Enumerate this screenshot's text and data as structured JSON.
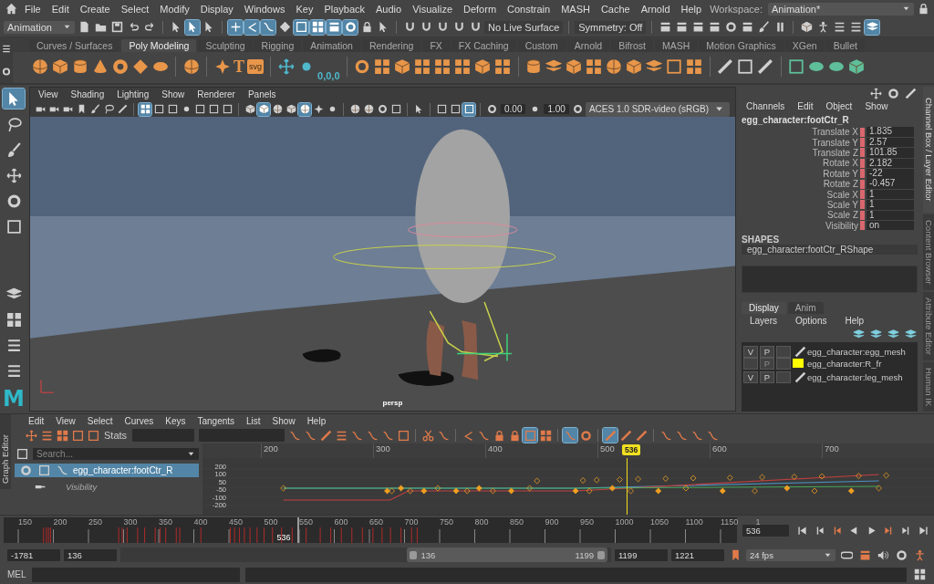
{
  "menu_bar": {
    "items": [
      "File",
      "Edit",
      "Create",
      "Select",
      "Modify",
      "Display",
      "Windows",
      "Key",
      "Playback",
      "Audio",
      "Visualize",
      "Deform",
      "Constrain",
      "MASH",
      "Cache",
      "Arnold",
      "Help"
    ],
    "workspace_label": "Workspace:",
    "workspace": "Animation*"
  },
  "status_line": {
    "mode": "Animation",
    "live_surface": "No Live Surface",
    "symmetry": "Symmetry: Off",
    "tools": [
      {
        "kind": "file",
        "selected": false
      },
      {
        "kind": "folder",
        "selected": false
      },
      {
        "kind": "floppy-disk",
        "selected": false
      },
      {
        "kind": "undo",
        "selected": false
      },
      {
        "kind": "redo",
        "selected": false
      },
      {
        "kind": "sep"
      },
      {
        "kind": "arrow-cursor",
        "selected": false
      },
      {
        "kind": "arrow-cursor",
        "selected": true
      },
      {
        "kind": "arrow-cursor",
        "selected": false
      },
      {
        "kind": "sep"
      },
      {
        "kind": "plus",
        "selected": true
      },
      {
        "kind": "angle",
        "selected": true
      },
      {
        "kind": "curve",
        "selected": true
      },
      {
        "kind": "diamond",
        "selected": false
      },
      {
        "kind": "square",
        "selected": true
      },
      {
        "kind": "grid",
        "selected": true
      },
      {
        "kind": "clapperboard",
        "selected": true
      },
      {
        "kind": "ring",
        "selected": true
      },
      {
        "kind": "lock",
        "selected": false
      },
      {
        "kind": "arrow-cursor",
        "selected": false
      },
      {
        "kind": "sep"
      },
      {
        "kind": "magnet",
        "selected": false
      },
      {
        "kind": "magnet",
        "selected": false
      },
      {
        "kind": "magnet",
        "selected": false
      },
      {
        "kind": "magnet",
        "selected": false
      },
      {
        "kind": "magnet",
        "selected": false
      }
    ],
    "render_tools": [
      {
        "kind": "clapperboard",
        "selected": false
      },
      {
        "kind": "clapperboard",
        "selected": false
      },
      {
        "kind": "clapperboard",
        "selected": false
      },
      {
        "kind": "clapperboard",
        "selected": false
      },
      {
        "kind": "ring",
        "selected": false
      },
      {
        "kind": "clapperboard",
        "selected": false
      },
      {
        "kind": "brush",
        "selected": false
      },
      {
        "kind": "pause",
        "selected": false
      },
      {
        "kind": "sep"
      },
      {
        "kind": "cube",
        "selected": false
      },
      {
        "kind": "figure",
        "selected": false
      },
      {
        "kind": "bars",
        "selected": false
      },
      {
        "kind": "bars",
        "selected": false
      },
      {
        "kind": "layers",
        "selected": true
      }
    ]
  },
  "shelf": {
    "tabs": [
      {
        "label": "Curves / Surfaces",
        "selected": false
      },
      {
        "label": "Poly Modeling",
        "selected": true
      },
      {
        "label": "Sculpting",
        "selected": false
      },
      {
        "label": "Rigging",
        "selected": false
      },
      {
        "label": "Animation",
        "selected": false
      },
      {
        "label": "Rendering",
        "selected": false
      },
      {
        "label": "FX",
        "selected": false
      },
      {
        "label": "FX Caching",
        "selected": false
      },
      {
        "label": "Custom",
        "selected": false
      },
      {
        "label": "Arnold",
        "selected": false
      },
      {
        "label": "Bifrost",
        "selected": false
      },
      {
        "label": "MASH",
        "selected": false
      },
      {
        "label": "Motion Graphics",
        "selected": false
      },
      {
        "label": "XGen",
        "selected": false
      },
      {
        "label": "Bullet",
        "selected": false
      }
    ],
    "items": [
      {
        "kind": "sphere",
        "color": "#e8964a"
      },
      {
        "kind": "cube",
        "color": "#e8964a"
      },
      {
        "kind": "cylinder",
        "color": "#e8964a"
      },
      {
        "kind": "cone",
        "color": "#e8964a"
      },
      {
        "kind": "torus",
        "color": "#e8964a"
      },
      {
        "kind": "diamond",
        "color": "#e8964a"
      },
      {
        "kind": "disc",
        "color": "#e8964a"
      },
      {
        "kind": "sep"
      },
      {
        "kind": "sphere",
        "color": "#e8964a"
      },
      {
        "kind": "sep"
      },
      {
        "kind": "star",
        "color": "#e8964a"
      },
      {
        "kind": "glyph",
        "label": "T",
        "color": "#e8964a"
      },
      {
        "kind": "tag",
        "label": "svg",
        "color": "#e8964a"
      },
      {
        "kind": "sep"
      },
      {
        "kind": "move-arrows",
        "color": "#4fb8cc"
      },
      {
        "kind": "dot",
        "color": "#4fb8cc"
      },
      {
        "kind": "glyph",
        "label": "0,0,0",
        "color": "#4fb8cc"
      },
      {
        "kind": "sep"
      },
      {
        "kind": "ring",
        "color": "#e8964a"
      },
      {
        "kind": "grid",
        "color": "#e8964a"
      },
      {
        "kind": "cube",
        "color": "#e8964a"
      },
      {
        "kind": "grid",
        "color": "#e8964a"
      },
      {
        "kind": "grid",
        "color": "#e8964a"
      },
      {
        "kind": "grid",
        "color": "#e8964a"
      },
      {
        "kind": "cube",
        "color": "#e8964a"
      },
      {
        "kind": "grid",
        "color": "#e8964a"
      },
      {
        "kind": "sep"
      },
      {
        "kind": "cylinder",
        "color": "#e8964a"
      },
      {
        "kind": "layers",
        "color": "#e8964a"
      },
      {
        "kind": "cube",
        "color": "#e8964a"
      },
      {
        "kind": "grid",
        "color": "#e8964a"
      },
      {
        "kind": "sphere",
        "color": "#e8964a"
      },
      {
        "kind": "cube",
        "color": "#e8964a"
      },
      {
        "kind": "layers",
        "color": "#e8964a"
      },
      {
        "kind": "square",
        "color": "#e8964a"
      },
      {
        "kind": "grid",
        "color": "#e8964a"
      },
      {
        "kind": "sep"
      },
      {
        "kind": "line",
        "color": "#cfcfcf"
      },
      {
        "kind": "square",
        "color": "#cfcfcf"
      },
      {
        "kind": "line",
        "color": "#cfcfcf"
      },
      {
        "kind": "sep"
      },
      {
        "kind": "square",
        "color": "#5fbf9a"
      },
      {
        "kind": "disc",
        "color": "#5fbf9a"
      },
      {
        "kind": "disc",
        "color": "#5fbf9a"
      },
      {
        "kind": "cube",
        "color": "#5fbf9a"
      }
    ]
  },
  "toolbox": {
    "tools": [
      {
        "kind": "arrow-cursor",
        "selected": true
      },
      {
        "kind": "lasso",
        "selected": false
      },
      {
        "kind": "brush",
        "selected": false
      },
      {
        "kind": "move-arrows",
        "selected": false
      },
      {
        "kind": "ring",
        "selected": false
      },
      {
        "kind": "square",
        "selected": false
      }
    ],
    "layouts": [
      {
        "kind": "layers"
      },
      {
        "kind": "grid"
      },
      {
        "kind": "bars"
      },
      {
        "kind": "bars"
      }
    ],
    "logo": "M"
  },
  "viewport": {
    "menu": [
      "View",
      "Shading",
      "Lighting",
      "Show",
      "Renderer",
      "Panels"
    ],
    "tools": [
      {
        "kind": "camera",
        "selected": false
      },
      {
        "kind": "camera",
        "selected": false
      },
      {
        "kind": "camera",
        "selected": false
      },
      {
        "kind": "bookmark",
        "selected": false
      },
      {
        "kind": "brush",
        "selected": false
      },
      {
        "kind": "lasso",
        "selected": false
      },
      {
        "kind": "line",
        "selected": false
      },
      {
        "kind": "sep"
      },
      {
        "kind": "grid",
        "selected": true
      },
      {
        "kind": "square",
        "selected": false
      },
      {
        "kind": "square",
        "selected": false
      },
      {
        "kind": "dot",
        "selected": false
      },
      {
        "kind": "square",
        "selected": false
      },
      {
        "kind": "square",
        "selected": false
      },
      {
        "kind": "square",
        "selected": false
      },
      {
        "kind": "sep"
      },
      {
        "kind": "cube",
        "selected": false
      },
      {
        "kind": "cube",
        "selected": true
      },
      {
        "kind": "sphere",
        "selected": false
      },
      {
        "kind": "cube",
        "selected": false
      },
      {
        "kind": "sphere",
        "selected": true
      },
      {
        "kind": "star",
        "selected": false
      },
      {
        "kind": "dot",
        "selected": false
      },
      {
        "kind": "sep"
      },
      {
        "kind": "sphere",
        "selected": false
      },
      {
        "kind": "sphere",
        "selected": false
      },
      {
        "kind": "ring",
        "selected": false
      },
      {
        "kind": "square",
        "selected": false
      },
      {
        "kind": "sep"
      },
      {
        "kind": "arrow-cursor",
        "selected": false
      },
      {
        "kind": "sep"
      },
      {
        "kind": "square",
        "selected": false
      },
      {
        "kind": "square",
        "selected": false
      },
      {
        "kind": "square",
        "selected": true
      },
      {
        "kind": "sep"
      },
      {
        "kind": "ring",
        "selected": false
      }
    ],
    "exposure": "0.00",
    "gamma": "1.00",
    "color_space": "ACES 1.0 SDR-video (sRGB)",
    "camera": "persp"
  },
  "channel_box": {
    "menu": [
      "Channels",
      "Edit",
      "Object",
      "Show"
    ],
    "node": "egg_character:footCtr_R",
    "channels": [
      {
        "name": "Translate X",
        "value": "1.835"
      },
      {
        "name": "Translate Y",
        "value": "2.57"
      },
      {
        "name": "Translate Z",
        "value": "101.85"
      },
      {
        "name": "Rotate X",
        "value": "2.182"
      },
      {
        "name": "Rotate Y",
        "value": "-22"
      },
      {
        "name": "Rotate Z",
        "value": "-0.457"
      },
      {
        "name": "Scale X",
        "value": "1"
      },
      {
        "name": "Scale Y",
        "value": "1"
      },
      {
        "name": "Scale Z",
        "value": "1"
      },
      {
        "name": "Visibility",
        "value": "on"
      }
    ],
    "shapes_title": "SHAPES",
    "shape": "egg_character:footCtr_RShape"
  },
  "layer_editor": {
    "tabs": [
      {
        "label": "Display",
        "selected": true
      },
      {
        "label": "Anim",
        "selected": false
      }
    ],
    "menu": [
      "Layers",
      "Options",
      "Help"
    ],
    "layers": [
      {
        "v": "V",
        "p": "P",
        "p_disabled": false,
        "kind": "mesh",
        "name": "egg_character:egg_mesh"
      },
      {
        "p": "P",
        "p_disabled": true,
        "kind": "swatch",
        "color": "#ffff00",
        "name": "egg_character:R_fr"
      },
      {
        "v": "V",
        "p": "P",
        "p_disabled": false,
        "kind": "mesh",
        "name": "egg_character:leg_mesh"
      }
    ]
  },
  "side_tabs": [
    {
      "label": "Channel Box / Layer Editor",
      "selected": true
    },
    {
      "label": "Content Browser",
      "selected": false
    },
    {
      "label": "Attribute Editor",
      "selected": false
    },
    {
      "label": "Human IK",
      "selected": false
    }
  ],
  "graph_editor": {
    "tab": "Graph Editor",
    "menu": [
      "Edit",
      "View",
      "Select",
      "Curves",
      "Keys",
      "Tangents",
      "List",
      "Show",
      "Help"
    ],
    "stats_label": "Stats",
    "search_placeholder": "Search...",
    "tools": [
      {
        "kind": "curve",
        "selected": false
      },
      {
        "kind": "curve",
        "selected": false
      },
      {
        "kind": "line",
        "selected": false
      },
      {
        "kind": "bars",
        "selected": false
      },
      {
        "kind": "curve",
        "selected": false
      },
      {
        "kind": "curve",
        "selected": false
      },
      {
        "kind": "curve",
        "selected": false
      },
      {
        "kind": "square",
        "selected": false
      },
      {
        "kind": "sep"
      },
      {
        "kind": "cut",
        "selected": false
      },
      {
        "kind": "curve",
        "selected": false
      },
      {
        "kind": "sep"
      },
      {
        "kind": "angle",
        "selected": false
      },
      {
        "kind": "curve",
        "selected": false
      },
      {
        "kind": "lock",
        "selected": false
      },
      {
        "kind": "lock",
        "selected": false
      },
      {
        "kind": "square",
        "selected": true
      },
      {
        "kind": "grid",
        "selected": false
      },
      {
        "kind": "sep"
      },
      {
        "kind": "curve",
        "selected": true
      },
      {
        "kind": "ring",
        "selected": false
      },
      {
        "kind": "sep"
      },
      {
        "kind": "line",
        "selected": true
      },
      {
        "kind": "line",
        "selected": false
      },
      {
        "kind": "line",
        "selected": false
      },
      {
        "kind": "sep"
      },
      {
        "kind": "curve",
        "selected": false
      },
      {
        "kind": "curve",
        "selected": false
      },
      {
        "kind": "curve",
        "selected": false
      },
      {
        "kind": "curve",
        "selected": false
      }
    ],
    "outliner": [
      {
        "name": "egg_character:footCtr_R",
        "selected": true,
        "children": [
          {
            "name": "Visibility",
            "selected": false
          }
        ]
      }
    ],
    "ruler": [
      "200",
      "300",
      "400",
      "500",
      "600",
      "700"
    ],
    "current_frame": "536",
    "y_labels": [
      "200",
      "100",
      "50",
      "-50",
      "-100",
      "-200"
    ]
  },
  "time_slider": {
    "ticks": [
      "150",
      "200",
      "250",
      "300",
      "350",
      "400",
      "450",
      "500",
      "550",
      "600",
      "650",
      "700",
      "750",
      "800",
      "850",
      "900",
      "950",
      "1000",
      "1050",
      "1100",
      "1150",
      "1"
    ],
    "current_frame": "536",
    "frame_field": "536",
    "level": 0.4
  },
  "range_slider": {
    "anim_start": "-1781",
    "start": "136",
    "range_start": "136",
    "range_end": "1199",
    "end": "1199",
    "anim_end": "1221",
    "fps": "24 fps"
  },
  "command_line": {
    "language": "MEL"
  }
}
